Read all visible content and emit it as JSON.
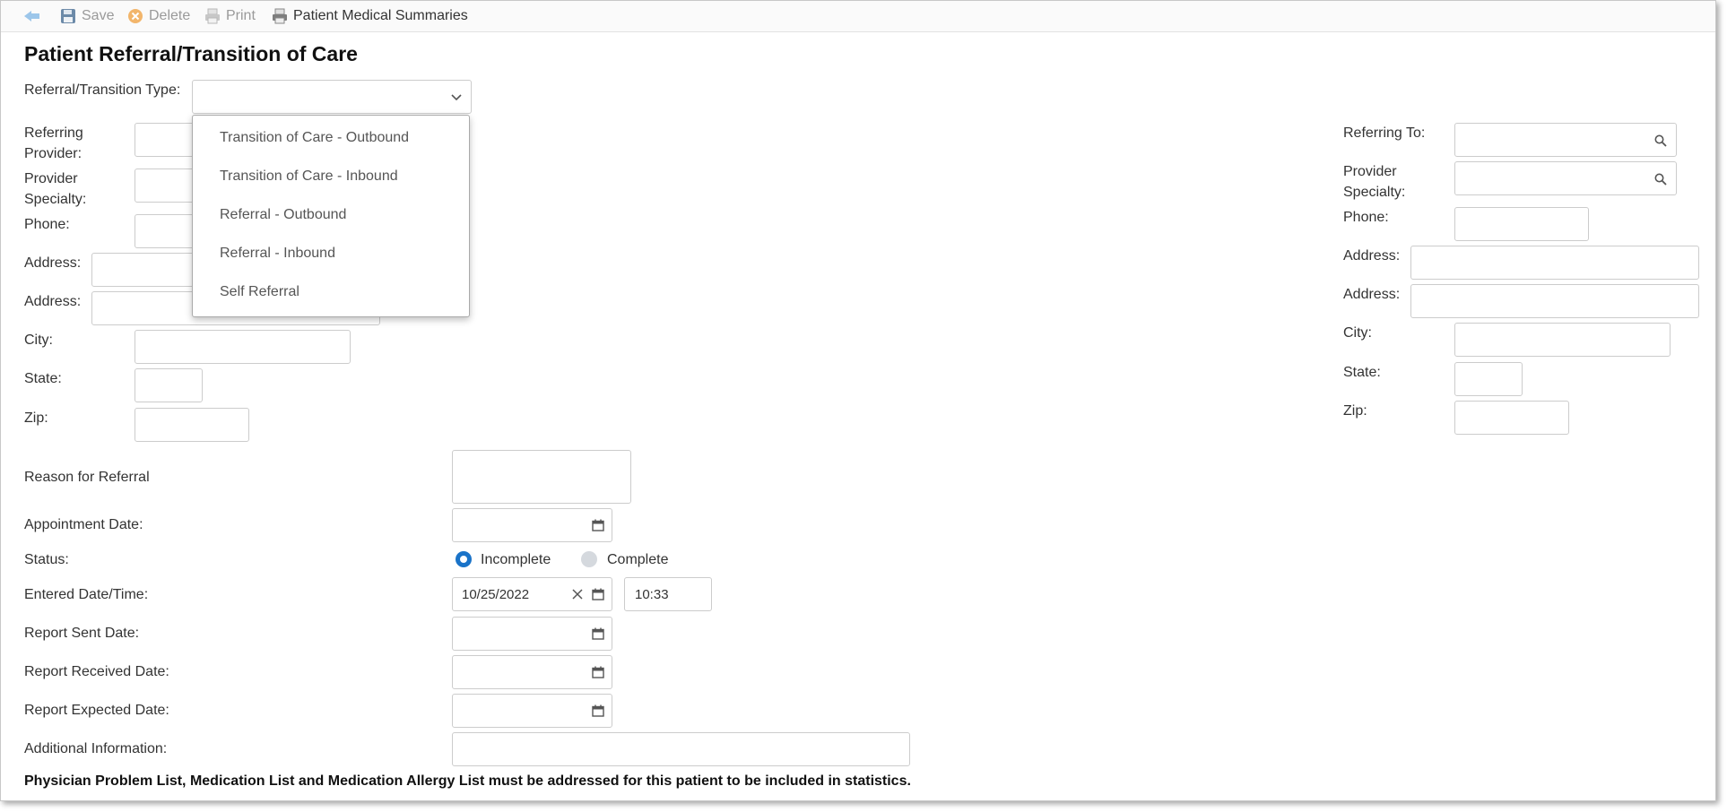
{
  "toolbar": {
    "back_icon": "back-arrow-icon",
    "save": "Save",
    "delete": "Delete",
    "print": "Print",
    "summaries": "Patient Medical Summaries"
  },
  "page_title": "Patient Referral/Transition of Care",
  "referral_type": {
    "label": "Referral/Transition Type:",
    "value": "",
    "options": [
      "Transition of Care - Outbound",
      "Transition of Care - Inbound",
      "Referral - Outbound",
      "Referral - Inbound",
      "Self Referral"
    ]
  },
  "left": {
    "referring_provider_l1": "Referring",
    "referring_provider_l2": "Provider:",
    "provider_specialty_l1": "Provider",
    "provider_specialty_l2": "Specialty:",
    "phone": "Phone:",
    "address1": "Address:",
    "address2": "Address:",
    "city": "City:",
    "state": "State:",
    "zip": "Zip:"
  },
  "right": {
    "referring_to": "Referring To:",
    "provider_specialty_l1": "Provider",
    "provider_specialty_l2": "Specialty:",
    "phone": "Phone:",
    "address1": "Address:",
    "address2": "Address:",
    "city": "City:",
    "state": "State:",
    "zip": "Zip:"
  },
  "details": {
    "reason": "Reason for Referral",
    "appointment_date": "Appointment Date:",
    "status": "Status:",
    "status_options": [
      "Incomplete",
      "Complete"
    ],
    "status_selected": "Incomplete",
    "entered": "Entered Date/Time:",
    "entered_date": "10/25/2022",
    "entered_time": "10:33",
    "report_sent": "Report Sent Date:",
    "report_received": "Report Received Date:",
    "report_expected": "Report Expected Date:",
    "additional": "Additional Information:"
  },
  "footer_note": "Physician Problem List, Medication List and Medication Allergy List must be addressed for this patient to be included in statistics.",
  "colors": {
    "accent": "#1a73c8",
    "radio_off": "#d5d9de"
  }
}
